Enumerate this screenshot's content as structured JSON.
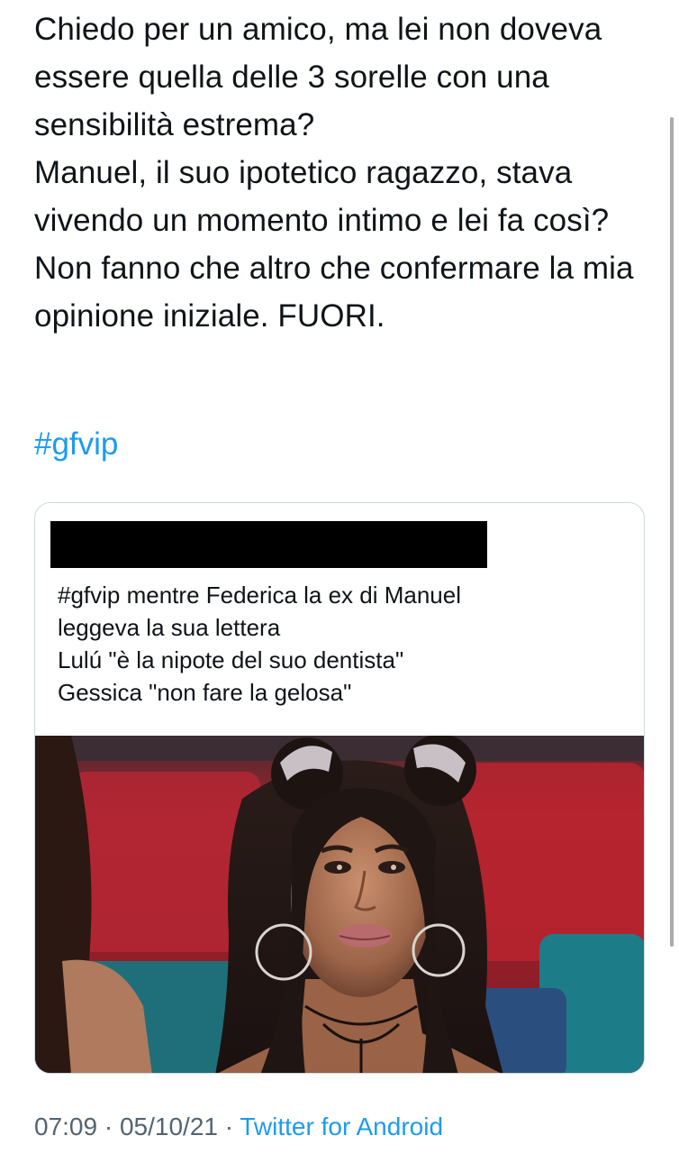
{
  "tweet": {
    "text": "Chiedo per un amico, ma lei non doveva essere quella delle 3 sorelle con una sensibilità estrema?\nManuel, il suo ipotetico ragazzo, stava vivendo un momento intimo e lei fa così?\nNon fanno che altro che confermare la mia opinione iniziale. FUORI.",
    "hashtag": "#gfvip"
  },
  "quoted_tweet": {
    "text": "#gfvip mentre Federica la ex di Manuel\nleggeva la sua  lettera\nLulú \"è la nipote del suo dentista\"\nGessica \"non fare la gelosa\""
  },
  "meta": {
    "time": "07:09",
    "separator": "·",
    "date": "05/10/21",
    "source": "Twitter for Android"
  },
  "colors": {
    "link": "#1d9bf0",
    "text": "#0f1419",
    "secondary": "#536471",
    "border": "#cfd9de"
  }
}
